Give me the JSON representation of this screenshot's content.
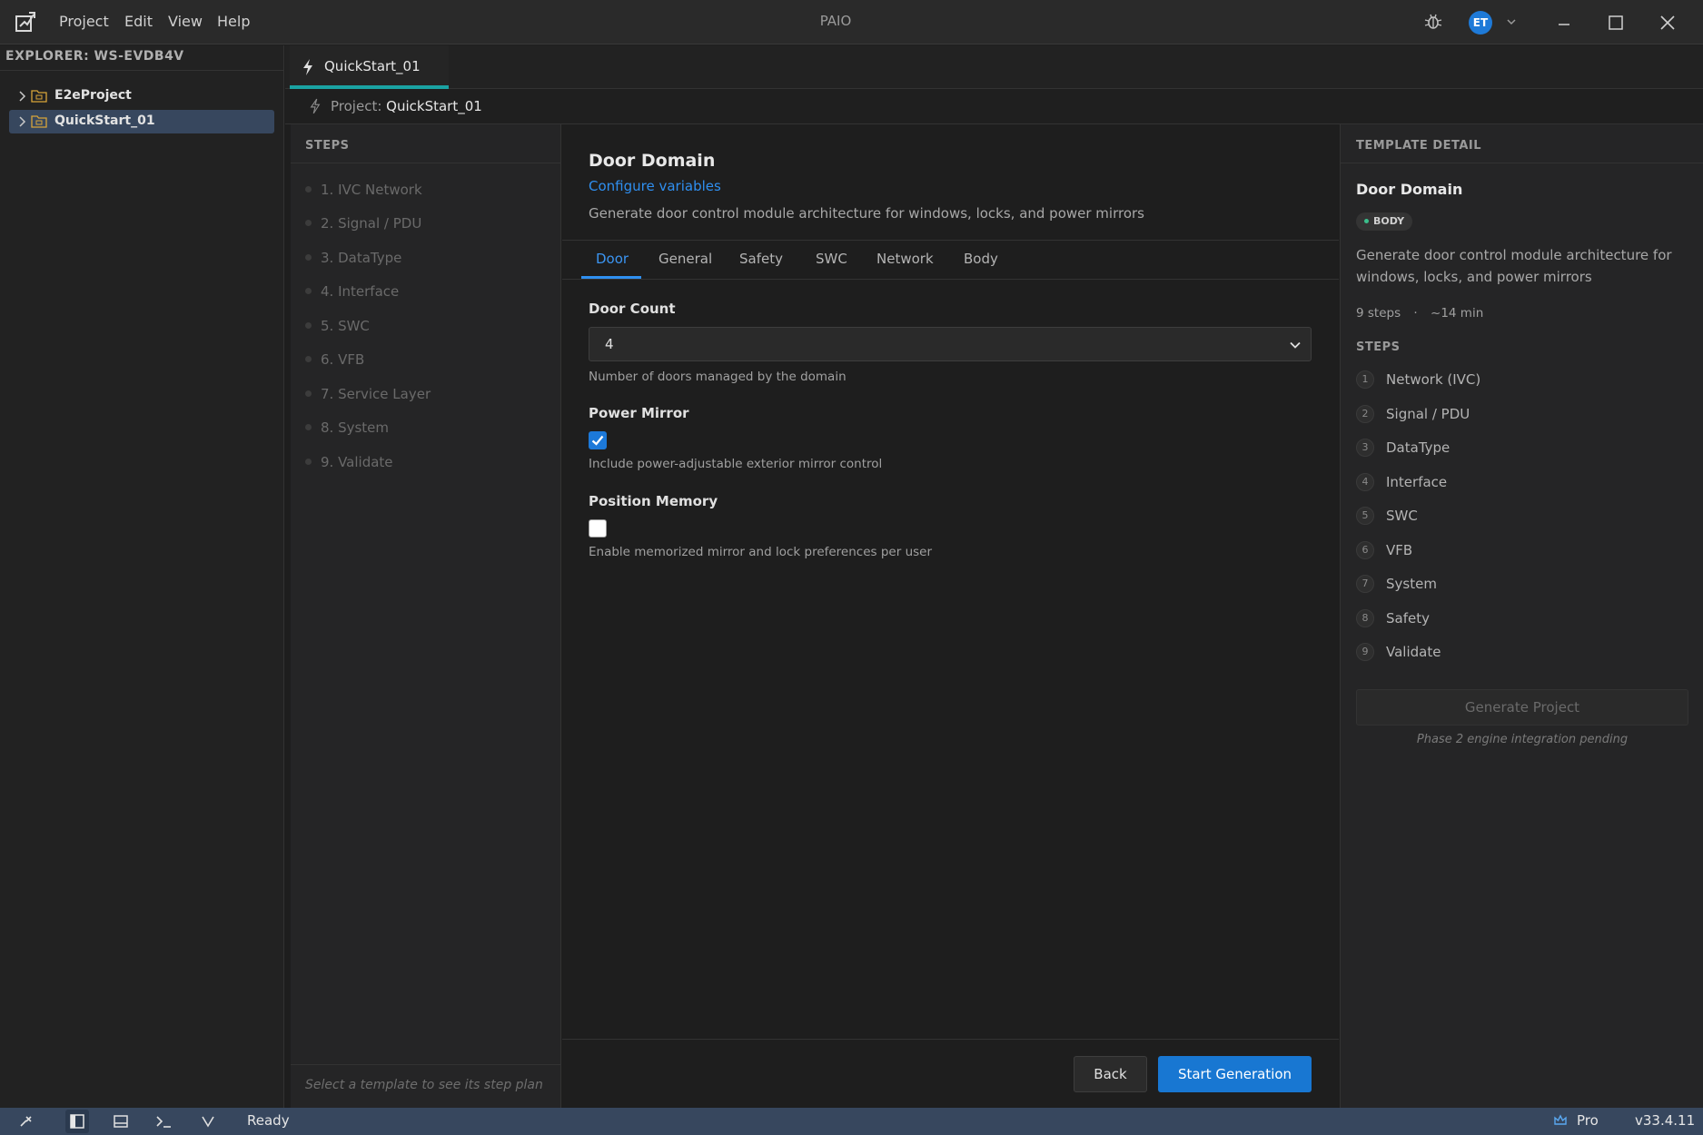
{
  "app": {
    "window_title": "PAIO",
    "menu": [
      "Project",
      "Edit",
      "View",
      "Help"
    ],
    "avatar_initials": "ET",
    "icons": [
      "app-logo-icon",
      "bug-icon",
      "chevron-down-icon",
      "minimize-icon",
      "maximize-icon",
      "close-icon"
    ]
  },
  "explorer": {
    "title": "EXPLORER: WS-EVDB4V",
    "items": [
      {
        "label": "E2eProject",
        "selected": false
      },
      {
        "label": "QuickStart_01",
        "selected": true
      }
    ]
  },
  "editor": {
    "tab_label": "QuickStart_01",
    "breadcrumb_prefix": "Project:",
    "breadcrumb_value": "QuickStart_01"
  },
  "steps_panel": {
    "heading": "STEPS",
    "items": [
      "1. IVC Network",
      "2. Signal / PDU",
      "3. DataType",
      "4. Interface",
      "5. SWC",
      "6. VFB",
      "7. Service Layer",
      "8. System",
      "9. Validate"
    ],
    "footer": "Select a template to see its step plan"
  },
  "form": {
    "title": "Door Domain",
    "link": "Configure variables",
    "description": "Generate door control module architecture for windows, locks, and power mirrors",
    "tabs": [
      "Door",
      "General",
      "Safety",
      "SWC",
      "Network",
      "Body"
    ],
    "active_tab": "Door",
    "door_count": {
      "label": "Door Count",
      "value": "4",
      "help": "Number of doors managed by the domain"
    },
    "power_mirror": {
      "label": "Power Mirror",
      "checked": true,
      "help": "Include power-adjustable exterior mirror control"
    },
    "position_memory": {
      "label": "Position Memory",
      "checked": false,
      "help": "Enable memorized mirror and lock preferences per user"
    },
    "back_label": "Back",
    "start_label": "Start Generation"
  },
  "detail": {
    "heading": "TEMPLATE DETAIL",
    "title": "Door Domain",
    "badge": "BODY",
    "description": "Generate door control module architecture for windows, locks, and power mirrors",
    "meta_steps": "9 steps",
    "meta_sep": "·",
    "meta_time": "~14 min",
    "steps_heading": "STEPS",
    "steps": [
      {
        "num": "1",
        "label": "Network (IVC)"
      },
      {
        "num": "2",
        "label": "Signal / PDU"
      },
      {
        "num": "3",
        "label": "DataType"
      },
      {
        "num": "4",
        "label": "Interface"
      },
      {
        "num": "5",
        "label": "SWC"
      },
      {
        "num": "6",
        "label": "VFB"
      },
      {
        "num": "7",
        "label": "System"
      },
      {
        "num": "8",
        "label": "Safety"
      },
      {
        "num": "9",
        "label": "Validate"
      }
    ],
    "generate_label": "Generate Project",
    "note": "Phase 2 engine integration pending"
  },
  "statusbar": {
    "status": "Ready",
    "plan": "Pro",
    "version": "v33.4.11"
  },
  "colors": {
    "accent": "#1877d2",
    "link": "#2f8ff0",
    "tab_indicator": "#1aa3a3",
    "statusbar": "#37475e",
    "badge_dot": "#3bbf8c"
  }
}
